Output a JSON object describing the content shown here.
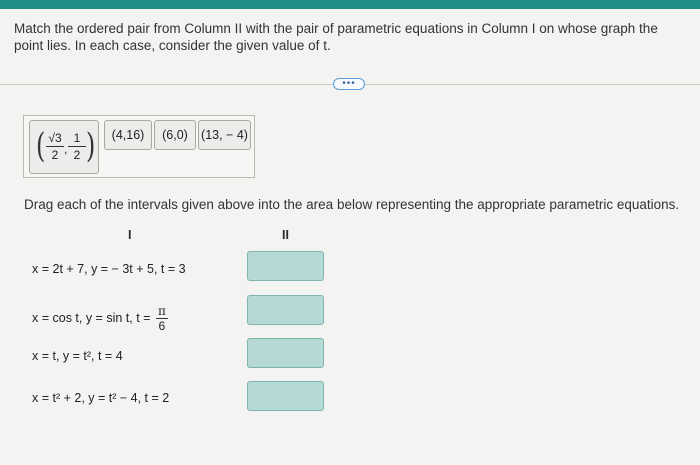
{
  "header": {
    "accent_color": "#1e8f86"
  },
  "instructions": "Match the ordered pair from Column II with the pair of parametric equations in Column I on whose graph the point lies. In each case, consider the given value of t.",
  "more_button": "•••",
  "answer_bank": {
    "tile0": {
      "num1": "√3",
      "den1": "2",
      "num2": "1",
      "den2": "2",
      "comma": ","
    },
    "tile1": "(4,16)",
    "tile2": "(6,0)",
    "tile3": "(13, − 4)"
  },
  "drag_instruction": "Drag each of the intervals given above into the area below representing the appropriate parametric equations.",
  "columns": {
    "col1": "I",
    "col2": "II"
  },
  "equations": [
    "x = 2t + 7, y = − 3t + 5, t = 3",
    "x = cos t, y = sin t, t =",
    "x = t, y = t², t = 4",
    "x = t² + 2, y = t² − 4, t = 2"
  ],
  "eq1_fraction": {
    "num": "π",
    "den": "6"
  },
  "drop_zone_color": "#b7d9d5"
}
